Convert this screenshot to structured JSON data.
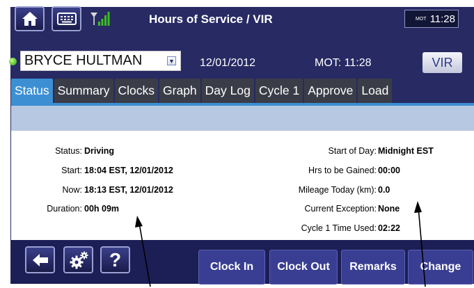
{
  "header": {
    "title": "Hours of Service / VIR",
    "clock_label": "MOT",
    "clock_time": "11:28",
    "icons": [
      "home-icon",
      "keyboard-icon",
      "signal-icon"
    ]
  },
  "driver_row": {
    "driver": "BRYCE HULTMAN",
    "date": "12/01/2012",
    "mot": "MOT: 11:28",
    "vir_label": "VIR",
    "status_color": "#3cbf1c"
  },
  "tabs": [
    {
      "label": "Status",
      "active": true
    },
    {
      "label": "Summary"
    },
    {
      "label": "Clocks"
    },
    {
      "label": "Graph"
    },
    {
      "label": "Day Log"
    },
    {
      "label": "Cycle 1"
    },
    {
      "label": "Approve"
    },
    {
      "label": "Load"
    }
  ],
  "status": {
    "left": [
      {
        "label": "Status:",
        "value": "Driving"
      },
      {
        "label": "Start:",
        "value": "18:04 EST, 12/01/2012"
      },
      {
        "label": "Now:",
        "value": "18:13 EST, 12/01/2012"
      },
      {
        "label": "Duration:",
        "value": "00h 09m"
      }
    ],
    "right": [
      {
        "label": "Start of Day:",
        "value": "Midnight EST"
      },
      {
        "label": "Hrs to be Gained:",
        "value": "00:00"
      },
      {
        "label": "Mileage Today (km):",
        "value": "0.0"
      },
      {
        "label": "Current Exception:",
        "value": "None"
      },
      {
        "label": "Cycle 1 Time Used:",
        "value": "02:22"
      }
    ]
  },
  "footer": {
    "help_label": "?",
    "buttons": [
      "Clock In",
      "Clock Out",
      "Remarks",
      "Change"
    ],
    "icons": [
      "back-arrow-icon",
      "settings-gears-icon",
      "help-icon"
    ]
  },
  "colors": {
    "panel": "#272a63",
    "tab_active": "#3d8fd4",
    "tab_inactive": "#3a3d47",
    "band": "#b6c8e2"
  }
}
